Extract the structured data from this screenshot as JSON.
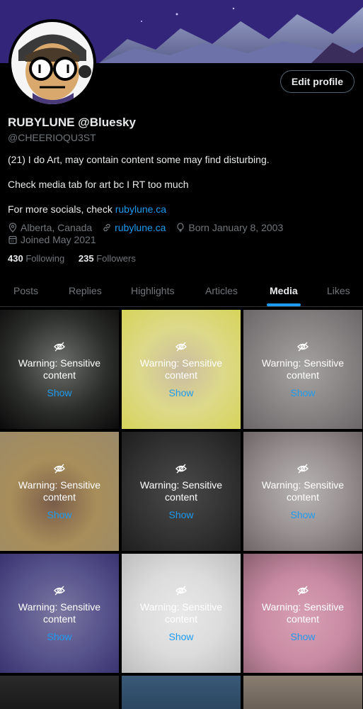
{
  "profile": {
    "edit_button": "Edit profile",
    "display_name": "RUBYLUNE @Bluesky",
    "handle": "@CHEERIOQU3ST",
    "bio_line1": "(21) I do Art, may contain content some may find disturbing.",
    "bio_line2": "Check media tab for art bc I RT too much",
    "bio_line3_prefix": "For more socials, check ",
    "bio_line3_link": "rubylune.ca",
    "location": "Alberta, Canada",
    "website": "rubylune.ca",
    "birthday": "Born January 8, 2003",
    "joined": "Joined May 2021",
    "following_count": "430",
    "following_label": "Following",
    "followers_count": "235",
    "followers_label": "Followers"
  },
  "tabs": [
    "Posts",
    "Replies",
    "Highlights",
    "Articles",
    "Media",
    "Likes"
  ],
  "active_tab": "Media",
  "media": {
    "warning_text": "Warning: Sensitive content",
    "show_label": "Show"
  },
  "colors": {
    "accent": "#1d9bf0",
    "muted": "#71767b",
    "text": "#e7e9ea",
    "border": "#2f3336"
  },
  "icons": [
    "location-icon",
    "link-icon",
    "balloon-icon",
    "calendar-icon",
    "eye-slash-icon"
  ]
}
